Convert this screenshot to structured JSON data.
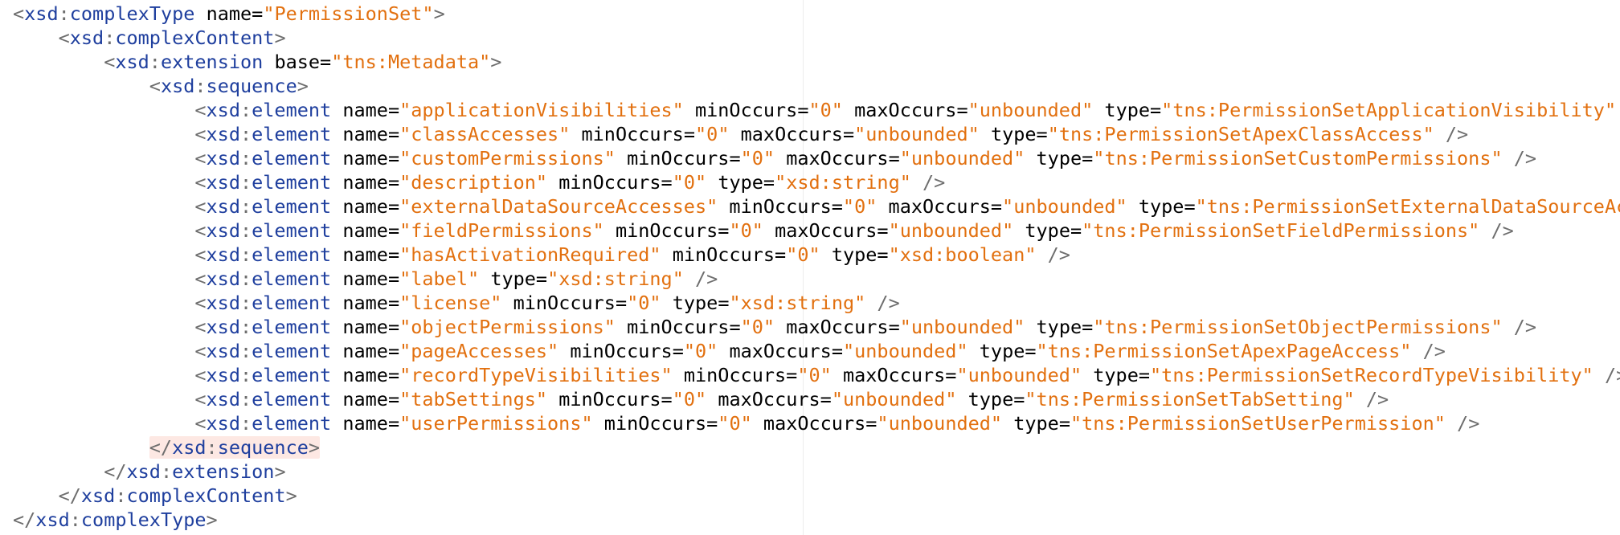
{
  "editor": {
    "language": "xml",
    "colors": {
      "background": "#ffffff",
      "punctuation": "#6e6e6e",
      "tag": "#1f3f9e",
      "attribute": "#000000",
      "value": "#e2700f",
      "bracket_match_highlight": "#fde8e3"
    },
    "lines": [
      {
        "indent": "",
        "open": "<",
        "ns": "xsd",
        "tag": "complexType",
        "attrs": [
          {
            "name": "name",
            "value": "PermissionSet"
          }
        ],
        "close": ">"
      },
      {
        "indent": "    ",
        "open": "<",
        "ns": "xsd",
        "tag": "complexContent",
        "attrs": [],
        "close": ">"
      },
      {
        "indent": "        ",
        "open": "<",
        "ns": "xsd",
        "tag": "extension",
        "attrs": [
          {
            "name": "base",
            "value": "tns:Metadata"
          }
        ],
        "close": ">"
      },
      {
        "indent": "            ",
        "open": "<",
        "ns": "xsd",
        "tag": "sequence",
        "attrs": [],
        "close": ">"
      },
      {
        "indent": "                ",
        "open": "<",
        "ns": "xsd",
        "tag": "element",
        "attrs": [
          {
            "name": "name",
            "value": "applicationVisibilities"
          },
          {
            "name": "minOccurs",
            "value": "0"
          },
          {
            "name": "maxOccurs",
            "value": "unbounded"
          },
          {
            "name": "type",
            "value": "tns:PermissionSetApplicationVisibility"
          }
        ],
        "close": " />"
      },
      {
        "indent": "                ",
        "open": "<",
        "ns": "xsd",
        "tag": "element",
        "attrs": [
          {
            "name": "name",
            "value": "classAccesses"
          },
          {
            "name": "minOccurs",
            "value": "0"
          },
          {
            "name": "maxOccurs",
            "value": "unbounded"
          },
          {
            "name": "type",
            "value": "tns:PermissionSetApexClassAccess"
          }
        ],
        "close": " />"
      },
      {
        "indent": "                ",
        "open": "<",
        "ns": "xsd",
        "tag": "element",
        "attrs": [
          {
            "name": "name",
            "value": "customPermissions"
          },
          {
            "name": "minOccurs",
            "value": "0"
          },
          {
            "name": "maxOccurs",
            "value": "unbounded"
          },
          {
            "name": "type",
            "value": "tns:PermissionSetCustomPermissions"
          }
        ],
        "close": " />"
      },
      {
        "indent": "                ",
        "open": "<",
        "ns": "xsd",
        "tag": "element",
        "attrs": [
          {
            "name": "name",
            "value": "description"
          },
          {
            "name": "minOccurs",
            "value": "0"
          },
          {
            "name": "type",
            "value": "xsd:string"
          }
        ],
        "close": " />"
      },
      {
        "indent": "                ",
        "open": "<",
        "ns": "xsd",
        "tag": "element",
        "attrs": [
          {
            "name": "name",
            "value": "externalDataSourceAccesses"
          },
          {
            "name": "minOccurs",
            "value": "0"
          },
          {
            "name": "maxOccurs",
            "value": "unbounded"
          },
          {
            "name": "type",
            "value": "tns:PermissionSetExternalDataSourceAccess"
          }
        ],
        "close": " />"
      },
      {
        "indent": "                ",
        "open": "<",
        "ns": "xsd",
        "tag": "element",
        "attrs": [
          {
            "name": "name",
            "value": "fieldPermissions"
          },
          {
            "name": "minOccurs",
            "value": "0"
          },
          {
            "name": "maxOccurs",
            "value": "unbounded"
          },
          {
            "name": "type",
            "value": "tns:PermissionSetFieldPermissions"
          }
        ],
        "close": " />"
      },
      {
        "indent": "                ",
        "open": "<",
        "ns": "xsd",
        "tag": "element",
        "attrs": [
          {
            "name": "name",
            "value": "hasActivationRequired"
          },
          {
            "name": "minOccurs",
            "value": "0"
          },
          {
            "name": "type",
            "value": "xsd:boolean"
          }
        ],
        "close": " />"
      },
      {
        "indent": "                ",
        "open": "<",
        "ns": "xsd",
        "tag": "element",
        "attrs": [
          {
            "name": "name",
            "value": "label"
          },
          {
            "name": "type",
            "value": "xsd:string"
          }
        ],
        "close": " />"
      },
      {
        "indent": "                ",
        "open": "<",
        "ns": "xsd",
        "tag": "element",
        "attrs": [
          {
            "name": "name",
            "value": "license"
          },
          {
            "name": "minOccurs",
            "value": "0"
          },
          {
            "name": "type",
            "value": "xsd:string"
          }
        ],
        "close": " />"
      },
      {
        "indent": "                ",
        "open": "<",
        "ns": "xsd",
        "tag": "element",
        "attrs": [
          {
            "name": "name",
            "value": "objectPermissions"
          },
          {
            "name": "minOccurs",
            "value": "0"
          },
          {
            "name": "maxOccurs",
            "value": "unbounded"
          },
          {
            "name": "type",
            "value": "tns:PermissionSetObjectPermissions"
          }
        ],
        "close": " />"
      },
      {
        "indent": "                ",
        "open": "<",
        "ns": "xsd",
        "tag": "element",
        "attrs": [
          {
            "name": "name",
            "value": "pageAccesses"
          },
          {
            "name": "minOccurs",
            "value": "0"
          },
          {
            "name": "maxOccurs",
            "value": "unbounded"
          },
          {
            "name": "type",
            "value": "tns:PermissionSetApexPageAccess"
          }
        ],
        "close": " />"
      },
      {
        "indent": "                ",
        "open": "<",
        "ns": "xsd",
        "tag": "element",
        "attrs": [
          {
            "name": "name",
            "value": "recordTypeVisibilities"
          },
          {
            "name": "minOccurs",
            "value": "0"
          },
          {
            "name": "maxOccurs",
            "value": "unbounded"
          },
          {
            "name": "type",
            "value": "tns:PermissionSetRecordTypeVisibility"
          }
        ],
        "close": " />"
      },
      {
        "indent": "                ",
        "open": "<",
        "ns": "xsd",
        "tag": "element",
        "attrs": [
          {
            "name": "name",
            "value": "tabSettings"
          },
          {
            "name": "minOccurs",
            "value": "0"
          },
          {
            "name": "maxOccurs",
            "value": "unbounded"
          },
          {
            "name": "type",
            "value": "tns:PermissionSetTabSetting"
          }
        ],
        "close": " />"
      },
      {
        "indent": "                ",
        "open": "<",
        "ns": "xsd",
        "tag": "element",
        "attrs": [
          {
            "name": "name",
            "value": "userPermissions"
          },
          {
            "name": "minOccurs",
            "value": "0"
          },
          {
            "name": "maxOccurs",
            "value": "unbounded"
          },
          {
            "name": "type",
            "value": "tns:PermissionSetUserPermission"
          }
        ],
        "close": " />"
      },
      {
        "indent": "            ",
        "open": "</",
        "ns": "xsd",
        "tag": "sequence",
        "attrs": [],
        "close": ">",
        "highlight": true
      },
      {
        "indent": "        ",
        "open": "</",
        "ns": "xsd",
        "tag": "extension",
        "attrs": [],
        "close": ">"
      },
      {
        "indent": "    ",
        "open": "</",
        "ns": "xsd",
        "tag": "complexContent",
        "attrs": [],
        "close": ">"
      },
      {
        "indent": "",
        "open": "</",
        "ns": "xsd",
        "tag": "complexType",
        "attrs": [],
        "close": ">"
      }
    ]
  }
}
